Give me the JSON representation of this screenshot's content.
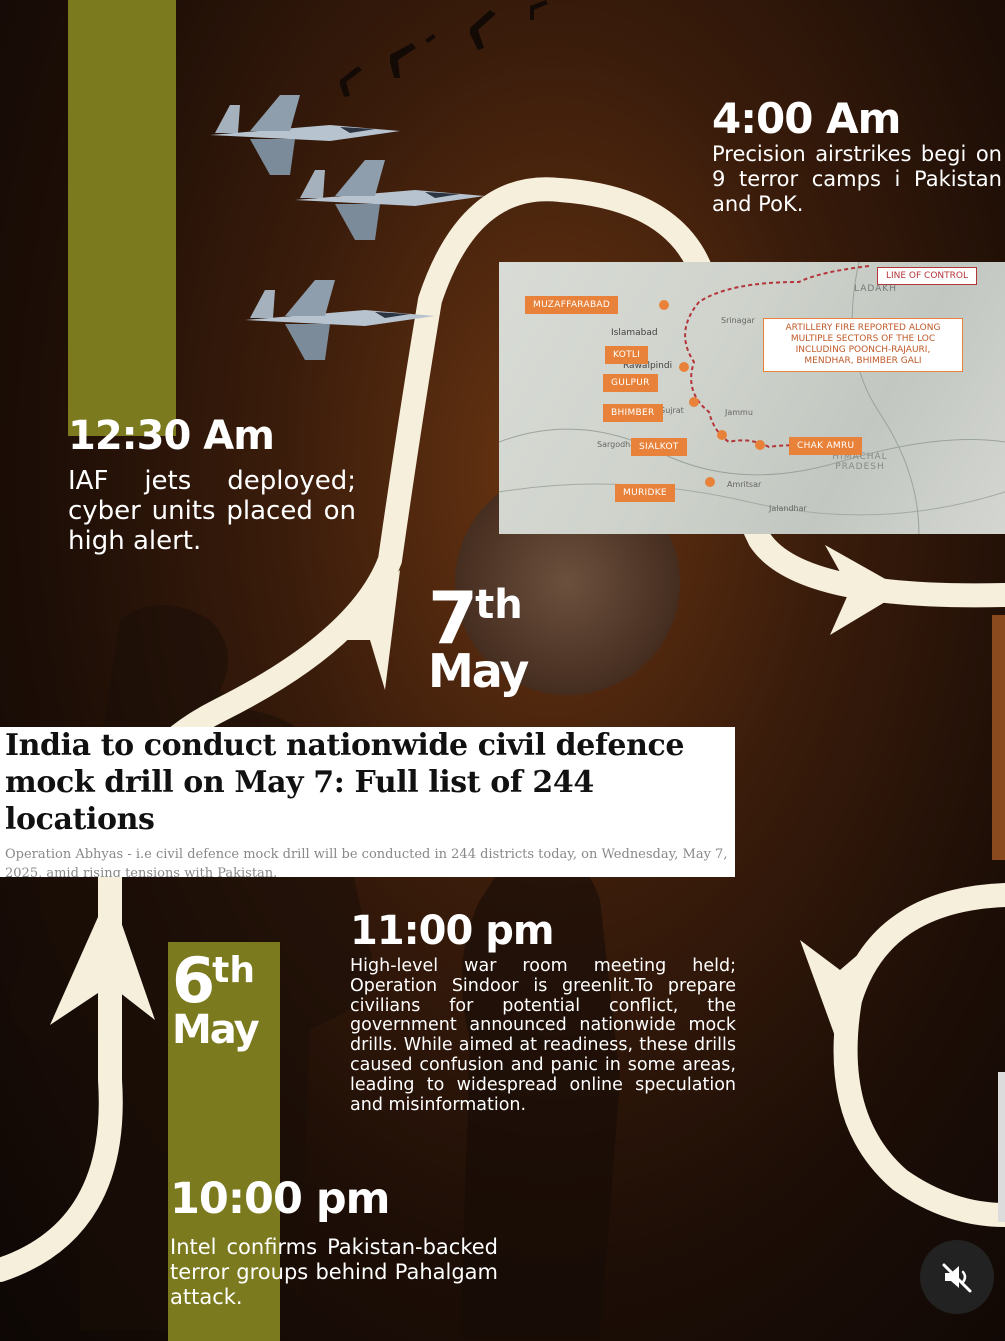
{
  "timeline": {
    "e1230": {
      "time": "12:30 Am",
      "desc": "IAF jets deployed; cyber units placed on high alert."
    },
    "e400": {
      "time": "4:00 Am",
      "desc": "Precision airstrikes begi on 9 terror camps i Pakistan and PoK."
    },
    "e1100": {
      "time": "11:00 pm",
      "desc": "High-level war room meeting held; Operation Sindoor is greenlit.To prepare civilians for potential conflict, the government announced nationwide mock drills. While aimed at readiness, these drills caused confusion and panic in some areas, leading to widespread online speculation and misinformation."
    },
    "e1000": {
      "time": "10:00 pm",
      "desc": "Intel confirms Pakistan-backed terror groups behind Pahalgam attack."
    }
  },
  "dates": {
    "may7": {
      "num": "7",
      "sup": "th",
      "month": "May"
    },
    "may6": {
      "num": "6",
      "sup": "th",
      "month": "May"
    }
  },
  "news": {
    "headline": "India to conduct nationwide civil defence mock drill on May 7: Full list of 244 locations",
    "subline": "Operation Abhyas - i.e civil defence mock drill will be conducted in 244 districts today, on Wednesday, May 7, 2025, amid rising tensions with Pakistan."
  },
  "map": {
    "loc_label": "LINE OF CONTROL",
    "callout": "ARTILLERY FIRE REPORTED ALONG MULTIPLE SECTORS OF THE LOC INCLUDING POONCH-RAJAURI, MENDHAR, BHIMBER GALI",
    "locations": [
      "MUZAFFARABAD",
      "KOTLI",
      "GULPUR",
      "BHIMBER",
      "SIALKOT",
      "MURIDKE",
      "CHAK AMRU"
    ],
    "places": {
      "ladakh": "LADAKH",
      "himachal": "HIMACHAL PRADESH",
      "islamabad": "Islamabad",
      "rawalpindi": "Rawalpindi",
      "jammu": "Jammu",
      "srinagar": "Srinagar",
      "amritsar": "Amritsar",
      "jalandhar": "Jalandhar",
      "gujrat": "Gujrat",
      "sargodha": "Sargodha"
    }
  },
  "colors": {
    "olive": "#7b7a1f",
    "path": "#f6efdc",
    "marker": "#e8823a"
  },
  "icons": {
    "mute": "speaker-muted-icon"
  }
}
